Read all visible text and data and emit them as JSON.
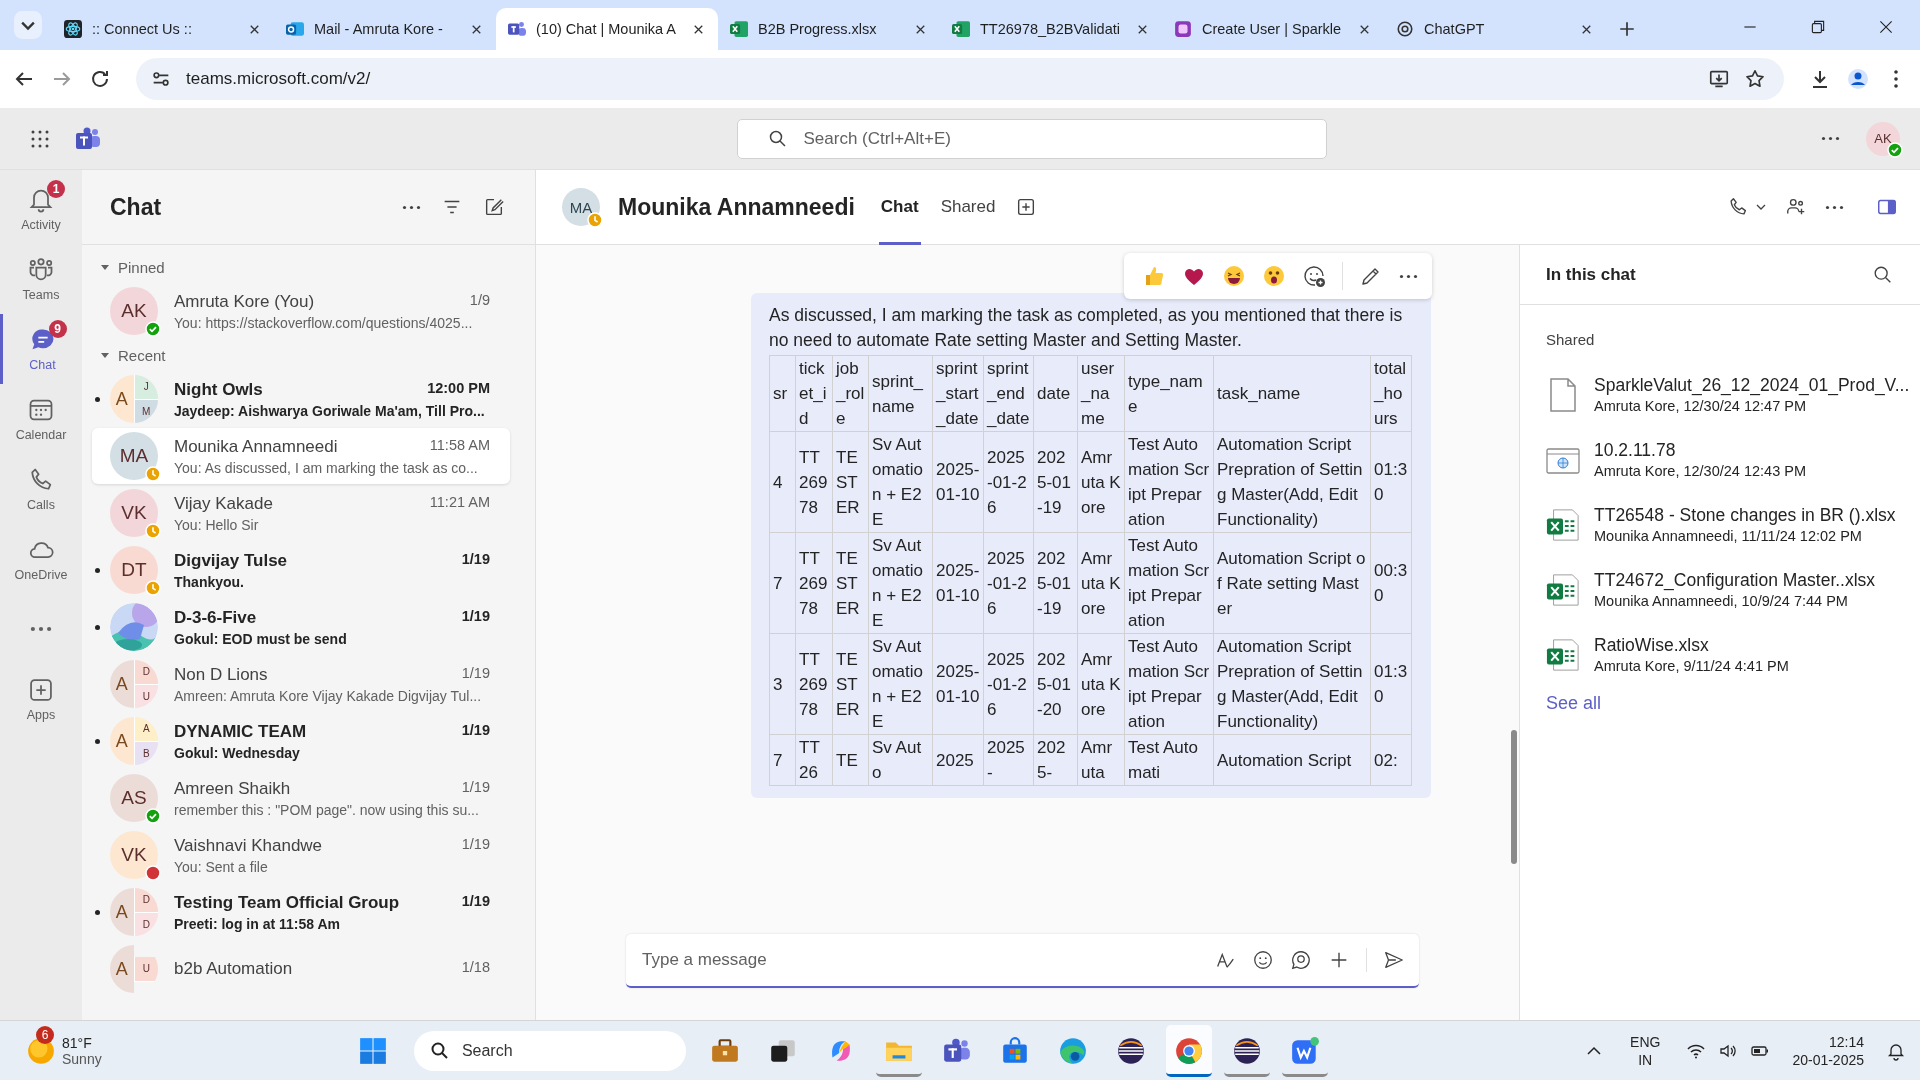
{
  "browser": {
    "tabs": [
      {
        "title": ":: Connect Us ::",
        "selected": false
      },
      {
        "title": "Mail - Amruta Kore -",
        "selected": false
      },
      {
        "title": "(10) Chat | Mounika A",
        "selected": true
      },
      {
        "title": "B2B Progress.xlsx",
        "selected": false
      },
      {
        "title": "TT26978_B2BValidati",
        "selected": false
      },
      {
        "title": "Create User | Sparkle",
        "selected": false
      },
      {
        "title": "ChatGPT",
        "selected": false
      }
    ],
    "url": "teams.microsoft.com/v2/"
  },
  "teams_bar": {
    "search_placeholder": "Search (Ctrl+Alt+E)",
    "avatar": {
      "initials": "AK",
      "color": "#f2d6da",
      "presence": {
        "kind": "available",
        "color": "#13a10e"
      }
    }
  },
  "rail": [
    {
      "label": "Activity",
      "badge": "1",
      "selected": false
    },
    {
      "label": "Teams",
      "selected": false
    },
    {
      "label": "Chat",
      "badge": "9",
      "selected": true
    },
    {
      "label": "Calendar",
      "selected": false
    },
    {
      "label": "Calls",
      "selected": false
    },
    {
      "label": "OneDrive",
      "selected": false
    },
    {
      "selected": false
    },
    {
      "label": "Apps",
      "selected": false
    }
  ],
  "chat_list": {
    "title": "Chat",
    "sections": [
      {
        "label": "Pinned",
        "expanded": true,
        "items": [
          {
            "name": "Amruta Kore (You)",
            "time": "1/9",
            "preview": "You: https://stackoverflow.com/questions/4025...",
            "avatar": {
              "kind": "initials",
              "text": "AK",
              "color": "#f2d6da"
            },
            "presence": {
              "kind": "available",
              "color": "#13a10e"
            },
            "unread": false,
            "selected": false
          }
        ]
      },
      {
        "label": "Recent",
        "expanded": true,
        "items": [
          {
            "name": "Night Owls",
            "time": "12:00 PM",
            "preview": "Jaydeep: Aishwarya Goriwale Ma'am,   Till Pro...",
            "avatar": {
              "kind": "group",
              "members": [
                {
                  "letter": "A",
                  "color": "#fde7d0"
                },
                {
                  "letter": "J",
                  "color": "#d6ede0"
                },
                {
                  "letter": "M",
                  "color": "#cfdce3"
                }
              ]
            },
            "unread": true,
            "selected": false
          },
          {
            "name": "Mounika Annamneedi",
            "time": "11:58 AM",
            "preview": "You: As discussed, I am marking the task as co...",
            "avatar": {
              "kind": "initials",
              "text": "MA",
              "color": "#d3dfe5"
            },
            "presence": {
              "kind": "away",
              "color": "#eaa300"
            },
            "unread": false,
            "selected": true
          },
          {
            "name": "Vijay Kakade",
            "time": "11:21 AM",
            "preview": "You: Hello Sir",
            "avatar": {
              "kind": "initials",
              "text": "VK",
              "color": "#f2d6da"
            },
            "presence": {
              "kind": "away",
              "color": "#eaa300"
            },
            "unread": false,
            "selected": false
          },
          {
            "name": "Digvijay Tulse",
            "time": "1/19",
            "preview": "Thankyou.",
            "avatar": {
              "kind": "initials",
              "text": "DT",
              "color": "#f8dad2"
            },
            "presence": {
              "kind": "away",
              "color": "#eaa300"
            },
            "unread": true,
            "selected": false
          },
          {
            "name": "D-3-6-Five",
            "time": "1/19",
            "preview": "Gokul: EOD must be send",
            "unread": true,
            "selected": false
          },
          {
            "name": "Non D Lions",
            "time": "1/19",
            "preview": "Amreen: Amruta Kore Vijay Kakade Digvijay Tul...",
            "avatar": {
              "kind": "group",
              "members": [
                {
                  "letter": "A",
                  "color": "#ecdcd8"
                },
                {
                  "letter": "D",
                  "color": "#f8dad2"
                },
                {
                  "letter": "U",
                  "color": "#f9e0e3"
                }
              ]
            },
            "unread": false,
            "selected": false
          },
          {
            "name": "DYNAMIC TEAM",
            "time": "1/19",
            "preview": "Gokul: Wednesday",
            "avatar": {
              "kind": "group",
              "members": [
                {
                  "letter": "A",
                  "color": "#fde7d0"
                },
                {
                  "letter": "A",
                  "color": "#fdf0c8"
                },
                {
                  "letter": "B",
                  "color": "#e8e0f3"
                }
              ]
            },
            "unread": true,
            "selected": false
          },
          {
            "name": "Amreen Shaikh",
            "time": "1/19",
            "preview": "remember this : \"POM page\". now using this su...",
            "avatar": {
              "kind": "initials",
              "text": "AS",
              "color": "#ecdcd8"
            },
            "presence": {
              "kind": "available",
              "color": "#13a10e"
            },
            "unread": false,
            "selected": false
          },
          {
            "name": "Vaishnavi Khandwe",
            "time": "1/19",
            "preview": "You: Sent a file",
            "avatar": {
              "kind": "initials",
              "text": "VK",
              "color": "#fde7d0"
            },
            "presence": {
              "kind": "busy",
              "color": "#d13438"
            },
            "unread": false,
            "selected": false
          },
          {
            "name": "Testing Team Official Group",
            "time": "1/19",
            "preview": "Preeti: log in at 11:58 Am",
            "avatar": {
              "kind": "group",
              "members": [
                {
                  "letter": "A",
                  "color": "#ecdcd8"
                },
                {
                  "letter": "D",
                  "color": "#f8dad2"
                },
                {
                  "letter": "D",
                  "color": "#f9e0e3"
                }
              ]
            },
            "unread": true,
            "selected": false
          },
          {
            "name": "b2b Automation",
            "time": "1/18",
            "avatar": {
              "kind": "group",
              "members": [
                {
                  "letter": "A",
                  "color": "#ecdcd8"
                },
                {
                  "letter": "U",
                  "color": "#f8dad2"
                }
              ]
            },
            "unread": false,
            "selected": false
          }
        ]
      }
    ]
  },
  "conversation": {
    "avatar": {
      "initials": "MA",
      "color": "#d3dfe5",
      "presence": {
        "kind": "away",
        "color": "#eaa300"
      }
    },
    "name": "Mounika Annamneedi",
    "tabs": [
      {
        "label": "Chat",
        "selected": true
      },
      {
        "label": "Shared",
        "selected": false
      }
    ],
    "message": {
      "text": "As discussed, I am marking the task as completed, as you mentioned that there is no need to automate Rate setting Master and Setting Master.",
      "table": {
        "columns": [
          "sr",
          "ticket_id",
          "job_role",
          "sprint_name",
          "sprint_start_date",
          "sprint_end_date",
          "date",
          "user_name",
          "type_name",
          "task_name",
          "total_hours"
        ],
        "rows": [
          [
            "4",
            "TT26978",
            "TESTER",
            "Sv Automation + E2E",
            "2025-01-10",
            "2025-01-26",
            "2025-01-19",
            "Amruta Kore",
            "Test Automation Script Preparation",
            "Automation Script Prepration of Setting Master(Add, Edit Functionality)",
            "01:30"
          ],
          [
            "7",
            "TT26978",
            "TESTER",
            "Sv Automation + E2E",
            "2025-01-10",
            "2025-01-26",
            "2025-01-19",
            "Amruta Kore",
            "Test Automation Script Preparation",
            "Automation Script of Rate setting Master",
            "00:30"
          ],
          [
            "3",
            "TT26978",
            "TESTER",
            "Sv Automation + E2E",
            "2025-01-10",
            "2025-01-26",
            "2025-01-20",
            "Amruta Kore",
            "Test Automation Script Preparation",
            "Automation Script Prepration of Setting Master(Add, Edit Functionality)",
            "01:30"
          ],
          [
            "7",
            "TT26",
            "TE",
            "Sv Auto",
            "2025",
            "2025-",
            "2025-",
            "Amruta",
            "Test Automati",
            "Automation Script",
            "02:"
          ]
        ]
      }
    },
    "composer": {
      "placeholder": "Type a message"
    }
  },
  "side_panel": {
    "title": "In this chat",
    "section": "Shared",
    "files": [
      {
        "kind": "file",
        "name": "SparkleValut_26_12_2024_01_Prod_V...",
        "meta": "Amruta Kore, 12/30/24 12:47 PM"
      },
      {
        "kind": "link",
        "name": "10.2.11.78",
        "meta": "Amruta Kore, 12/30/24 12:43 PM"
      },
      {
        "kind": "sheet",
        "name": "TT26548 - Stone changes in BR ().xlsx",
        "meta": "Mounika Annamneedi, 11/11/24 12:02 PM"
      },
      {
        "kind": "sheet",
        "name": "TT24672_Configuration Master..xlsx",
        "meta": "Mounika Annamneedi, 10/9/24 7:44 PM"
      },
      {
        "kind": "sheet",
        "name": "RatioWise.xlsx",
        "meta": "Amruta Kore, 9/11/24 4:41 PM"
      }
    ],
    "see_all": "See all"
  },
  "taskbar": {
    "weather": {
      "badge": "6",
      "temperature": "81°F",
      "condition": "Sunny"
    },
    "search": "Search",
    "apps": [
      {
        "running": false,
        "selected": false
      },
      {
        "running": false,
        "selected": false
      },
      {
        "running": false,
        "selected": false
      },
      {
        "running": true,
        "selected": false
      },
      {
        "running": false,
        "selected": false
      },
      {
        "running": false,
        "selected": false
      },
      {
        "running": false,
        "selected": false
      },
      {
        "running": false,
        "selected": false
      },
      {
        "running": true,
        "selected": true
      },
      {
        "running": true,
        "selected": false
      },
      {
        "running": true,
        "selected": false
      }
    ],
    "language": "ENG",
    "region": "IN",
    "time": "12:14",
    "date": "20-01-2025"
  }
}
